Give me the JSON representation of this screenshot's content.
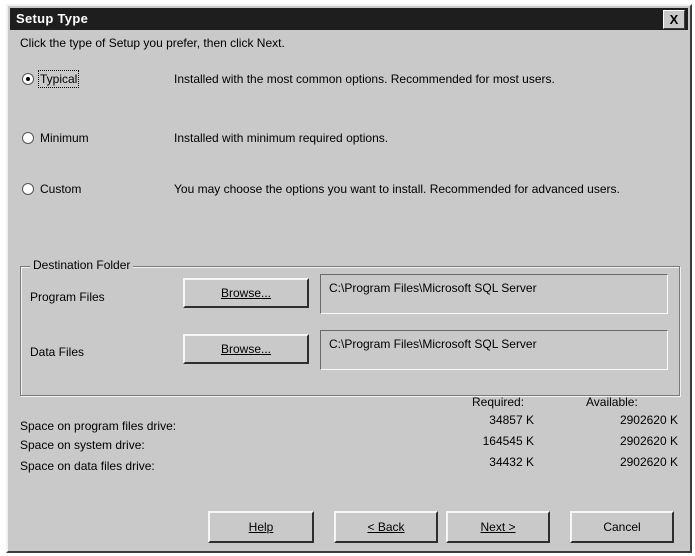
{
  "window": {
    "title": "Setup Type",
    "close_label": "X"
  },
  "instruction": "Click the type of Setup you prefer, then click Next.",
  "options": [
    {
      "label": "Typical",
      "description": "Installed with the most common options. Recommended for most users.",
      "selected": true
    },
    {
      "label": "Minimum",
      "description": "Installed with minimum required options.",
      "selected": false
    },
    {
      "label": "Custom",
      "description": "You may choose the options you want to install. Recommended for advanced users.",
      "selected": false
    }
  ],
  "destination": {
    "title": "Destination Folder",
    "program_files": {
      "label": "Program Files",
      "button": "Browse...",
      "path": "C:\\Program Files\\Microsoft SQL Server"
    },
    "data_files": {
      "label": "Data Files",
      "button": "Browse...",
      "path": "C:\\Program Files\\Microsoft SQL Server"
    }
  },
  "space": {
    "required_header": "Required:",
    "available_header": "Available:",
    "rows": [
      {
        "label": "Space on program files drive:",
        "required": "34857 K",
        "available": "2902620 K"
      },
      {
        "label": "Space on system drive:",
        "required": "164545 K",
        "available": "2902620 K"
      },
      {
        "label": "Space on data files drive:",
        "required": "34432 K",
        "available": "2902620 K"
      }
    ]
  },
  "buttons": {
    "help": "Help",
    "back": "< Back",
    "next": "Next >",
    "cancel": "Cancel"
  }
}
